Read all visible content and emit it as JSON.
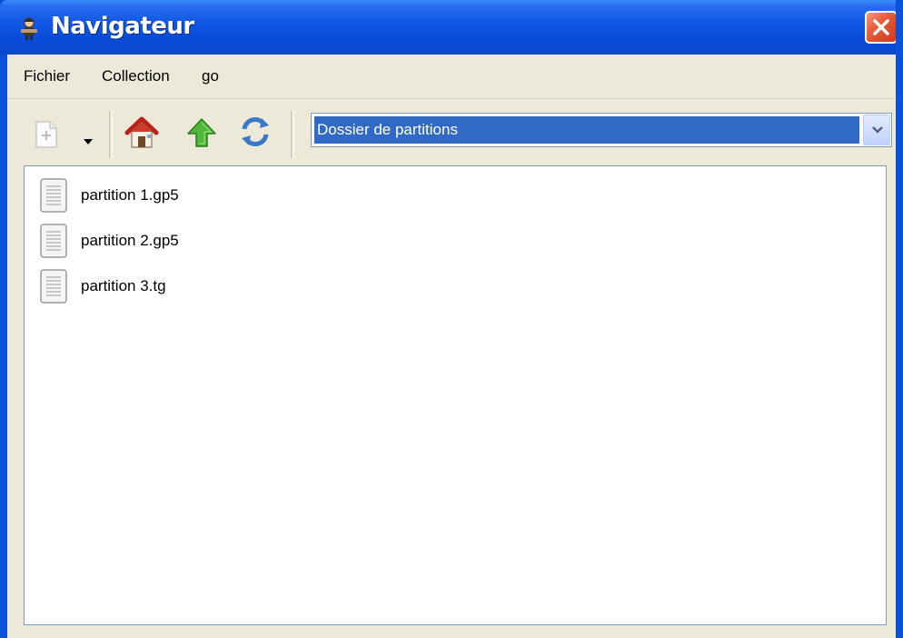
{
  "window": {
    "title": "Navigateur",
    "app_icon": "navigator-app-icon",
    "close_icon": "close-icon"
  },
  "menu": {
    "items": [
      {
        "label": "Fichier"
      },
      {
        "label": "Collection"
      },
      {
        "label": "go"
      }
    ]
  },
  "toolbar": {
    "buttons": [
      {
        "icon": "new-file-icon",
        "state": "disabled"
      },
      {
        "icon": "dropdown-arrow-icon"
      },
      {
        "icon": "home-icon"
      },
      {
        "icon": "up-arrow-icon"
      },
      {
        "icon": "refresh-icon"
      }
    ],
    "location": {
      "selected": "Dossier de partitions"
    }
  },
  "files": [
    {
      "name": "partition 1.gp5",
      "icon": "document-icon"
    },
    {
      "name": "partition 2.gp5",
      "icon": "document-icon"
    },
    {
      "name": "partition 3.tg",
      "icon": "document-icon"
    }
  ],
  "colors": {
    "titlebar": "#0a4ad6",
    "selection": "#316ac5",
    "close_button": "#e85d3b",
    "window_bg": "#ece9d8"
  }
}
